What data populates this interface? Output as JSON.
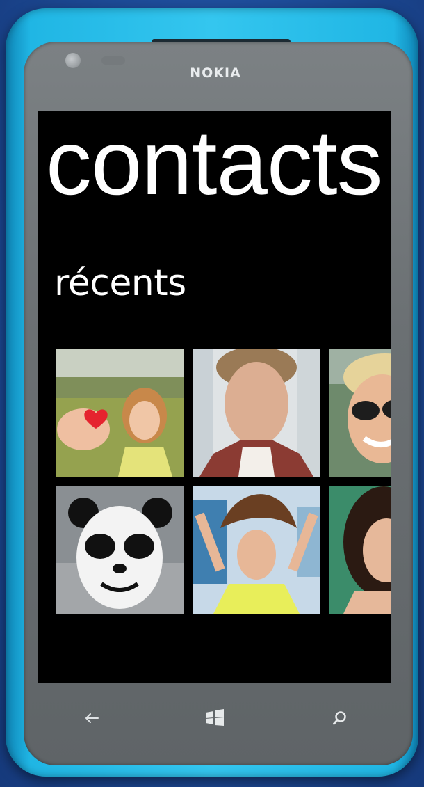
{
  "device": {
    "brand": "NOKIA",
    "shell_color": "#2ec0ec",
    "face_color": "#6b7073"
  },
  "screen": {
    "app_title": "contacts",
    "section_title": "récents",
    "accent_color": "#ffffff"
  },
  "contacts_recent": [
    {
      "id": "contact-1",
      "icon": "avatar-heart-girl"
    },
    {
      "id": "contact-2",
      "icon": "avatar-young-man"
    },
    {
      "id": "contact-3",
      "icon": "avatar-sunglasses-woman"
    },
    {
      "id": "contact-4",
      "icon": "avatar-panda-mask"
    },
    {
      "id": "contact-5",
      "icon": "avatar-windblown-woman"
    },
    {
      "id": "contact-6",
      "icon": "avatar-curly-hair-woman"
    }
  ],
  "nav": {
    "back_icon": "back-arrow-icon",
    "start_icon": "windows-logo-icon",
    "search_icon": "search-icon"
  }
}
